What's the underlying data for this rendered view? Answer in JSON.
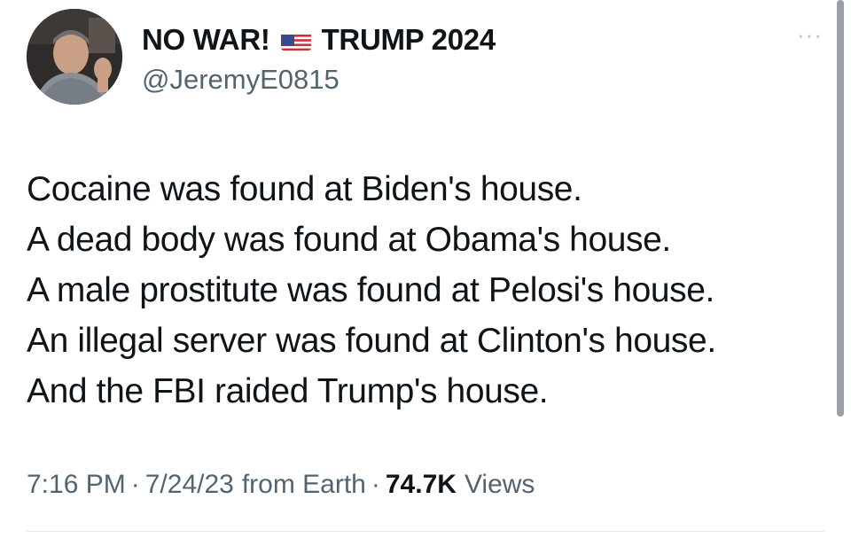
{
  "tweet": {
    "display_name_part1": "NO WAR!",
    "display_name_part2": "TRUMP 2024",
    "flag_icon": "us-flag-icon",
    "handle": "@JeremyE0815",
    "more_label": "···",
    "lines": [
      "Cocaine was found at Biden's house.",
      "A dead body was found at Obama's house.",
      "A male prostitute was found at Pelosi's house.",
      "An illegal server was found at Clinton's house.",
      "And the FBI raided Trump's house."
    ],
    "time": "7:16 PM",
    "date": "7/24/23",
    "source": "from Earth",
    "views_count": "74.7K",
    "views_label": "Views",
    "dot": "·"
  },
  "colors": {
    "text": "#0f1419",
    "secondary": "#536471",
    "divider": "#e6e9eb"
  }
}
